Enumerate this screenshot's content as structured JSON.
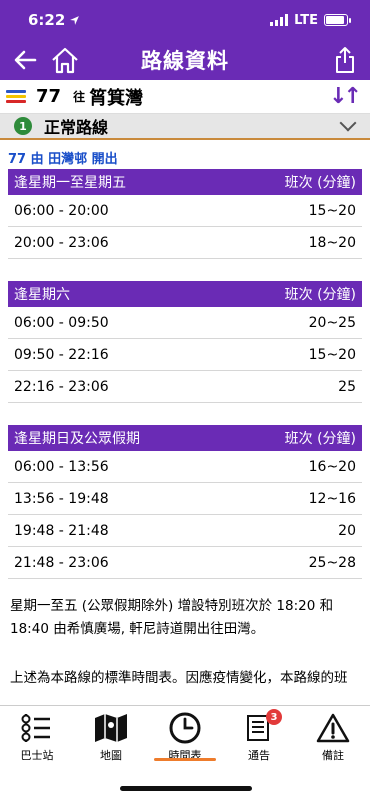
{
  "status": {
    "time": "6:22",
    "network": "LTE"
  },
  "header": {
    "title": "路線資料"
  },
  "route": {
    "number": "77",
    "to_label": "往",
    "destination": "筲箕灣",
    "swap_symbol": "↓↑"
  },
  "variant": {
    "index": "1",
    "label": "正常路線"
  },
  "departure": "77 由 田灣邨 開出",
  "schedules": [
    {
      "title": "逢星期一至星期五",
      "freq_header": "班次 (分鐘)",
      "rows": [
        {
          "time": "06:00 - 20:00",
          "freq": "15~20"
        },
        {
          "time": "20:00 - 23:06",
          "freq": "18~20"
        }
      ]
    },
    {
      "title": "逢星期六",
      "freq_header": "班次 (分鐘)",
      "rows": [
        {
          "time": "06:00 - 09:50",
          "freq": "20~25"
        },
        {
          "time": "09:50 - 22:16",
          "freq": "15~20"
        },
        {
          "time": "22:16 - 23:06",
          "freq": "25"
        }
      ]
    },
    {
      "title": "逢星期日及公眾假期",
      "freq_header": "班次 (分鐘)",
      "rows": [
        {
          "time": "06:00 - 13:56",
          "freq": "16~20"
        },
        {
          "time": "13:56 - 19:48",
          "freq": "12~16"
        },
        {
          "time": "19:48 - 21:48",
          "freq": "20"
        },
        {
          "time": "21:48 - 23:06",
          "freq": "25~28"
        }
      ]
    }
  ],
  "notes": {
    "special": "星期一至五 (公眾假期除外) 增設特別班次於 18:20 和 18:40 由希慎廣場, 軒尼詩道開出往田灣。",
    "disclaimer": "上述為本路線的標準時間表。因應疫情變化，本路線的班"
  },
  "tabs": [
    {
      "label": "巴士站",
      "icon": "bus-stop-icon"
    },
    {
      "label": "地圖",
      "icon": "map-icon"
    },
    {
      "label": "時間表",
      "icon": "clock-icon",
      "active": true
    },
    {
      "label": "通告",
      "icon": "notice-icon",
      "badge": "3"
    },
    {
      "label": "備註",
      "icon": "warning-icon"
    }
  ],
  "colors": {
    "brand": "#6a2bb5",
    "link": "#1a4fc9",
    "accent": "#ee7c2c",
    "badge": "#e23a3a",
    "variant": "#2e8b3a"
  }
}
